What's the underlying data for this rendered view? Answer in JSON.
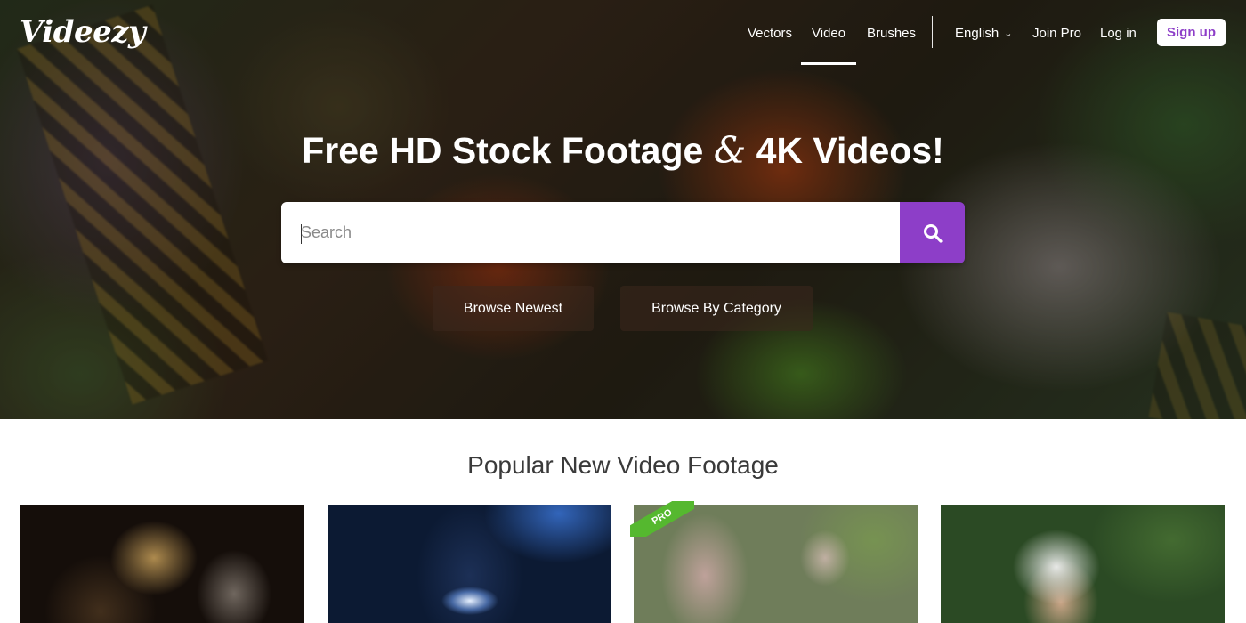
{
  "brand": {
    "logo_text": "Videezy"
  },
  "nav": {
    "vectors": "Vectors",
    "video": "Video",
    "brushes": "Brushes",
    "language": "English",
    "join_pro": "Join Pro",
    "log_in": "Log in",
    "sign_up": "Sign up",
    "active_item": "Video"
  },
  "hero": {
    "title_part1": "Free HD Stock Footage",
    "title_amp": "&",
    "title_part2": "4K Videos!",
    "search_placeholder": "Search",
    "browse_newest": "Browse Newest",
    "browse_by_category": "Browse By Category"
  },
  "popular": {
    "title": "Popular New Video Footage",
    "pro_badge": "PRO",
    "items": [
      {
        "pro": false
      },
      {
        "pro": false
      },
      {
        "pro": true
      },
      {
        "pro": false
      }
    ]
  },
  "colors": {
    "accent": "#8d3ec8",
    "pro_badge": "#55b82f"
  },
  "icons": {
    "search": "search-icon",
    "language_dropdown": "chevron-down-icon"
  }
}
